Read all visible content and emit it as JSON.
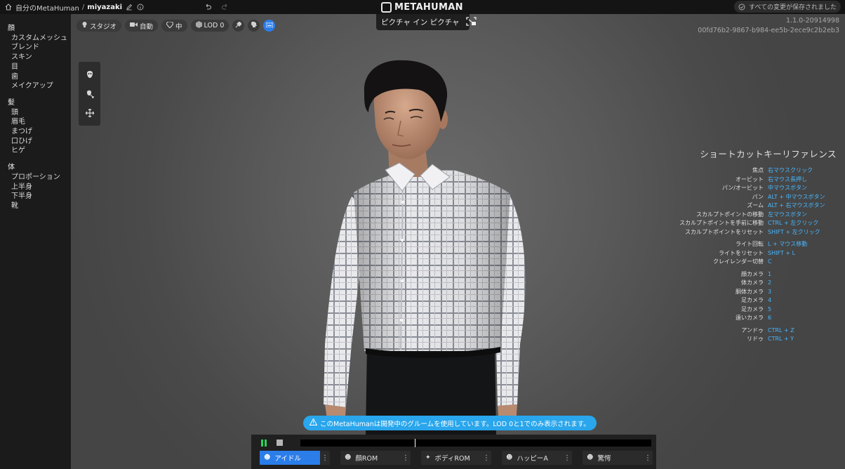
{
  "topbar": {
    "breadcrumb_home": "自分のMetaHuman",
    "breadcrumb_sep": "/",
    "breadcrumb_current": "miyazaki",
    "logo_text": "METAHUMAN",
    "save_status": "すべての変更が保存されました"
  },
  "sidebar": {
    "groups": [
      {
        "title": "顔",
        "items": [
          "カスタムメッシュ",
          "ブレンド",
          "スキン",
          "目",
          "歯",
          "メイクアップ"
        ]
      },
      {
        "title": "髪",
        "items": [
          "頭",
          "眉毛",
          "まつげ",
          "口ひげ",
          "ヒゲ"
        ]
      },
      {
        "title": "体",
        "items": [
          "プロポーション",
          "上半身",
          "下半身",
          "靴"
        ]
      }
    ]
  },
  "viewport": {
    "toolbar": {
      "studio": "スタジオ",
      "camera_auto": "自動",
      "quality": "中",
      "lod": "LOD 0"
    },
    "pip_label": "ピクチャ イン ピクチャ",
    "version": "1.1.0-20914998",
    "build_id": "00fd76b2-9867-b984-ee5b-2ece9c2b2eb3"
  },
  "shortcuts": {
    "title": "ショートカットキーリファレンス",
    "rows": [
      {
        "action": "焦点",
        "key": "右マウスクリック"
      },
      {
        "action": "オービット",
        "key": "右マウス長押し"
      },
      {
        "action": "パン/オービット",
        "key": "中マウスボタン"
      },
      {
        "action": "パン",
        "key": "ALT + 中マウスボタン"
      },
      {
        "action": "ズーム",
        "key": "ALT + 右マウスボタン"
      },
      {
        "action": "スカルプトポイントの移動",
        "key": "左マウスボタン"
      },
      {
        "action": "スカルプトポイントを手前に移動",
        "key": "CTRL + 左クリック"
      },
      {
        "action": "スカルプトポイントをリセット",
        "key": "SHIFT + 左クリック"
      },
      {
        "action": "ライト回転",
        "key": "L + マウス移動"
      },
      {
        "action": "ライトをリセット",
        "key": "SHIFT + L"
      },
      {
        "action": "クレイレンダー切替",
        "key": "C"
      },
      {
        "action": "顔カメラ",
        "key": "1"
      },
      {
        "action": "体カメラ",
        "key": "2"
      },
      {
        "action": "胴体カメラ",
        "key": "3"
      },
      {
        "action": "足カメラ",
        "key": "4"
      },
      {
        "action": "足カメラ",
        "key": "5"
      },
      {
        "action": "遠いカメラ",
        "key": "6"
      },
      {
        "action": "アンドゥ",
        "key": "CTRL + Z"
      },
      {
        "action": "リドゥ",
        "key": "CTRL + Y"
      }
    ]
  },
  "notice": "このMetaHumanは開発中のグルームを使用しています。LOD 0と1でのみ表示されます。",
  "playback": {
    "progress": 0.325,
    "anims": [
      {
        "label": "アイドル",
        "active": true
      },
      {
        "label": "顔ROM",
        "active": false
      },
      {
        "label": "ボディROM",
        "active": false
      },
      {
        "label": "ハッピーA",
        "active": false
      },
      {
        "label": "驚愕",
        "active": false
      }
    ]
  },
  "colors": {
    "accent": "#2b7de9",
    "notice": "#29a6ec",
    "shortcut_key": "#48b7ff",
    "play": "#2ad35e"
  }
}
